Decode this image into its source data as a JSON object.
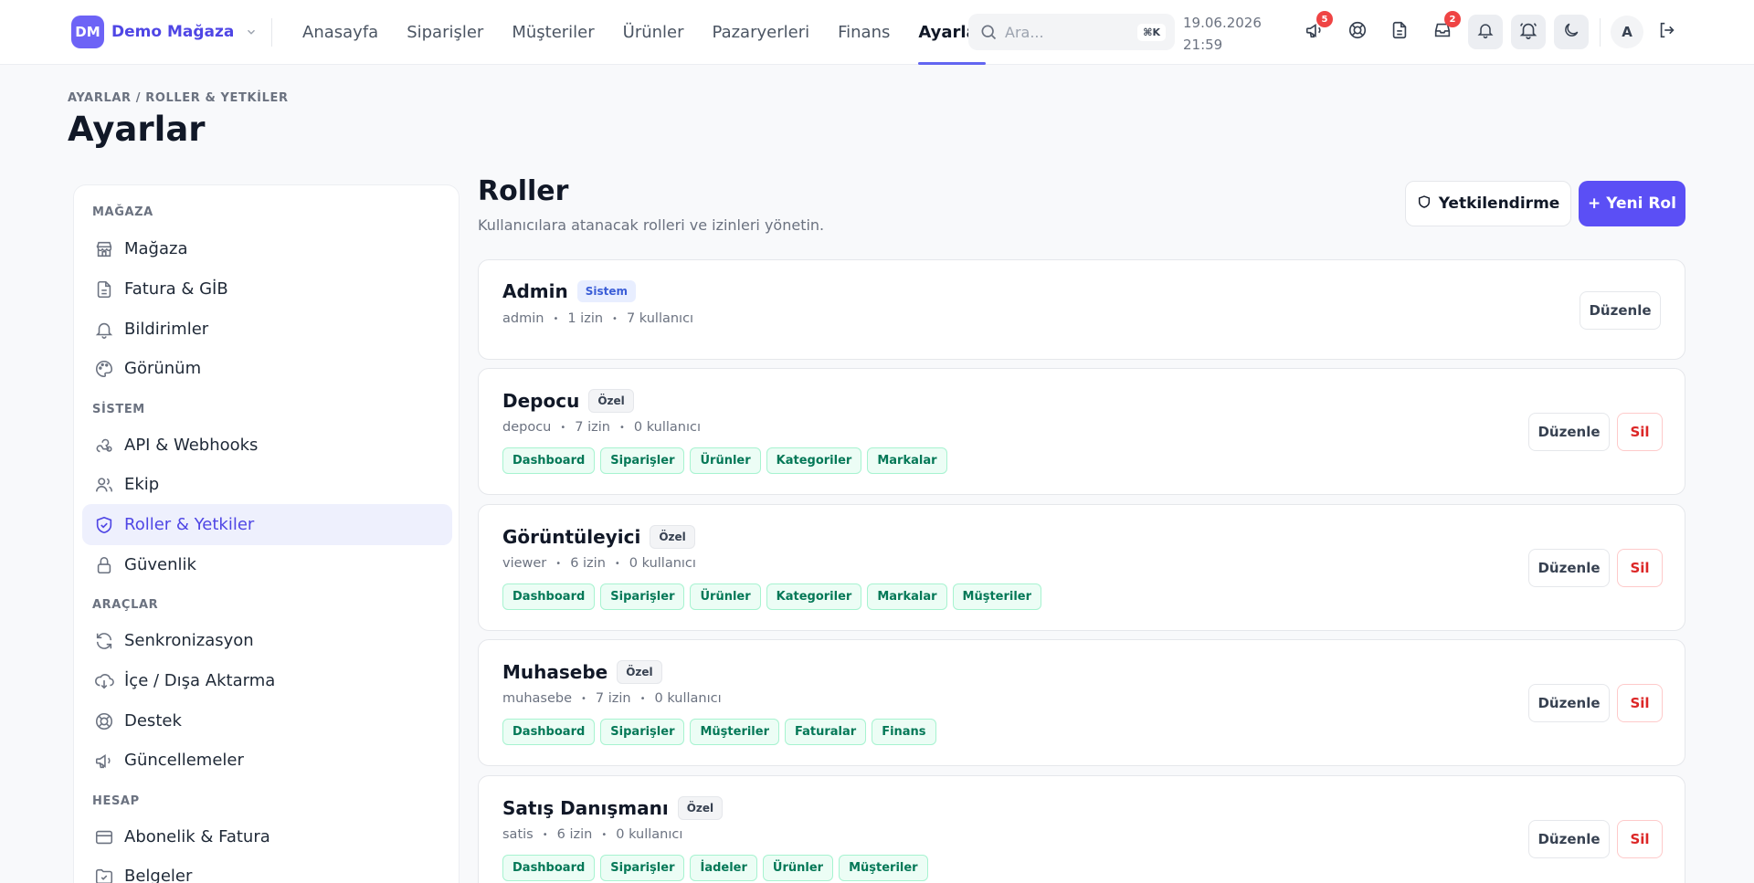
{
  "brand": {
    "initials": "DM",
    "name": "Demo Mağaza"
  },
  "nav": {
    "items": [
      "Anasayfa",
      "Siparişler",
      "Müşteriler",
      "Ürünler",
      "Pazaryerleri",
      "Finans",
      "Ayarlar"
    ],
    "active": "Ayarlar"
  },
  "search": {
    "placeholder": "Ara...",
    "shortcut": "⌘K"
  },
  "datetime": {
    "date": "19.06.2026",
    "time": "21:59"
  },
  "topicons": {
    "announcements_badge": "5",
    "inbox_badge": "2",
    "avatar_initial": "A"
  },
  "header": {
    "breadcrumb": "AYARLAR / ROLLER & YETKİLER",
    "title": "Ayarlar"
  },
  "sidebar": {
    "sections": {
      "store": "MAĞAZA",
      "system": "SİSTEM",
      "tools": "ARAÇLAR",
      "account": "HESAP"
    },
    "items": {
      "store": "Mağaza",
      "invoice": "Fatura & GİB",
      "notifications": "Bildirimler",
      "appearance": "Görünüm",
      "api": "API & Webhooks",
      "team": "Ekip",
      "roles": "Roller & Yetkiler",
      "security": "Güvenlik",
      "sync": "Senkronizasyon",
      "import": "İçe / Dışa Aktarma",
      "support": "Destek",
      "updates": "Güncellemeler",
      "billing": "Abonelik & Fatura",
      "documents": "Belgeler"
    }
  },
  "main": {
    "title": "Roller",
    "subtitle": "Kullanıcılara atanacak rolleri ve izinleri yönetin.",
    "auth_button": "Yetkilendirme",
    "new_button": "+ Yeni Rol",
    "edit_label": "Düzenle",
    "delete_label": "Sil"
  },
  "roles": [
    {
      "name": "Admin",
      "tag": "Sistem",
      "slug": "admin",
      "perms": "1 izin",
      "users": "7 kullanıcı",
      "chips": []
    },
    {
      "name": "Depocu",
      "tag": "Özel",
      "slug": "depocu",
      "perms": "7 izin",
      "users": "0 kullanıcı",
      "chips": [
        "Dashboard",
        "Siparişler",
        "Ürünler",
        "Kategoriler",
        "Markalar"
      ]
    },
    {
      "name": "Görüntüleyici",
      "tag": "Özel",
      "slug": "viewer",
      "perms": "6 izin",
      "users": "0 kullanıcı",
      "chips": [
        "Dashboard",
        "Siparişler",
        "Ürünler",
        "Kategoriler",
        "Markalar",
        "Müşteriler"
      ]
    },
    {
      "name": "Muhasebe",
      "tag": "Özel",
      "slug": "muhasebe",
      "perms": "7 izin",
      "users": "0 kullanıcı",
      "chips": [
        "Dashboard",
        "Siparişler",
        "Müşteriler",
        "Faturalar",
        "Finans"
      ]
    },
    {
      "name": "Satış Danışmanı",
      "tag": "Özel",
      "slug": "satis",
      "perms": "6 izin",
      "users": "0 kullanıcı",
      "chips": [
        "Dashboard",
        "Siparişler",
        "İadeler",
        "Ürünler",
        "Müşteriler"
      ]
    }
  ],
  "colors": {
    "accent": "#5b4ff5",
    "chip_green": "#047857",
    "danger": "#dc2626"
  }
}
